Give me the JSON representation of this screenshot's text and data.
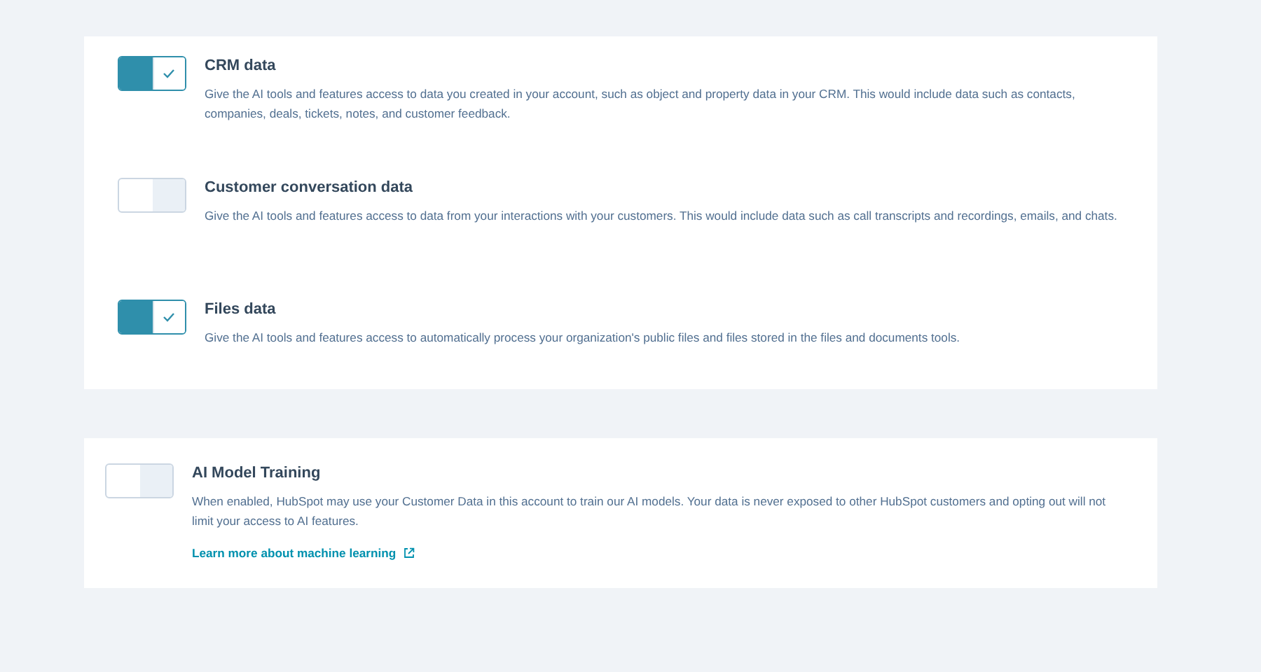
{
  "data_access": [
    {
      "title": "CRM data",
      "description": "Give the AI tools and features access to data you created in your account, such as object and property data in your CRM. This would include data such as contacts, companies, deals, tickets, notes, and customer feedback.",
      "on": true
    },
    {
      "title": "Customer conversation data",
      "description": "Give the AI tools and features access to data from your interactions with your customers. This would include data such as call transcripts and recordings, emails, and chats.",
      "on": false
    },
    {
      "title": "Files data",
      "description": "Give the AI tools and features access to automatically process your organization's public files and files stored in the files and documents tools.",
      "on": true
    }
  ],
  "model_training": {
    "title": "AI Model Training",
    "description": "When enabled, HubSpot may use your Customer Data in this account to train our AI models. Your data is never exposed to other HubSpot customers and opting out will not limit your access to AI features.",
    "on": false,
    "link": "Learn more about machine learning"
  }
}
